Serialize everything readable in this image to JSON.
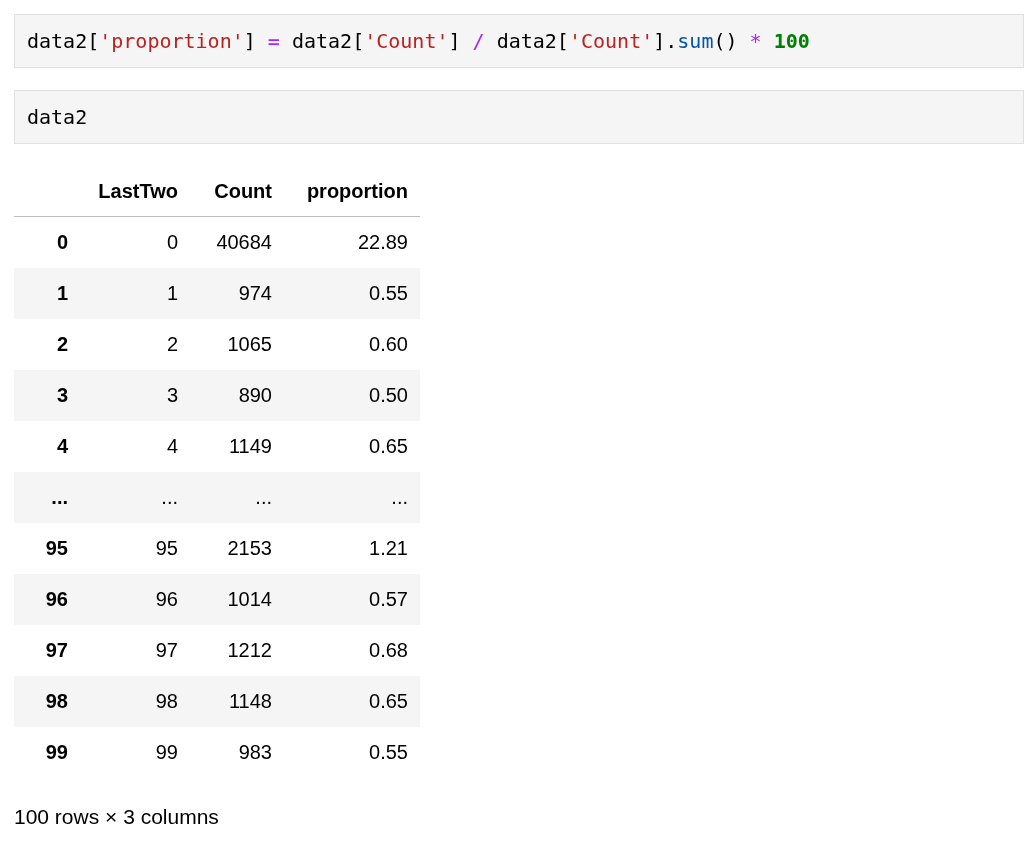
{
  "cells": [
    {
      "code": [
        {
          "kind": "name",
          "text": "data2["
        },
        {
          "kind": "string",
          "text": "'proportion'"
        },
        {
          "kind": "name",
          "text": "] "
        },
        {
          "kind": "operator",
          "text": "="
        },
        {
          "kind": "name",
          "text": " data2["
        },
        {
          "kind": "string",
          "text": "'Count'"
        },
        {
          "kind": "name",
          "text": "] "
        },
        {
          "kind": "operator",
          "text": "/"
        },
        {
          "kind": "name",
          "text": " data2["
        },
        {
          "kind": "string",
          "text": "'Count'"
        },
        {
          "kind": "name",
          "text": "]."
        },
        {
          "kind": "call",
          "text": "sum"
        },
        {
          "kind": "name",
          "text": "() "
        },
        {
          "kind": "operator",
          "text": "* "
        },
        {
          "kind": "number",
          "text": "100"
        }
      ]
    },
    {
      "code": [
        {
          "kind": "name",
          "text": "data2"
        }
      ]
    }
  ],
  "table": {
    "columns": [
      "LastTwo",
      "Count",
      "proportion"
    ],
    "rows": [
      {
        "index": "0",
        "cells": [
          "0",
          "40684",
          "22.89"
        ]
      },
      {
        "index": "1",
        "cells": [
          "1",
          "974",
          "0.55"
        ]
      },
      {
        "index": "2",
        "cells": [
          "2",
          "1065",
          "0.60"
        ]
      },
      {
        "index": "3",
        "cells": [
          "3",
          "890",
          "0.50"
        ]
      },
      {
        "index": "4",
        "cells": [
          "4",
          "1149",
          "0.65"
        ]
      },
      {
        "index": "...",
        "cells": [
          "...",
          "...",
          "..."
        ]
      },
      {
        "index": "95",
        "cells": [
          "95",
          "2153",
          "1.21"
        ]
      },
      {
        "index": "96",
        "cells": [
          "96",
          "1014",
          "0.57"
        ]
      },
      {
        "index": "97",
        "cells": [
          "97",
          "1212",
          "0.68"
        ]
      },
      {
        "index": "98",
        "cells": [
          "98",
          "1148",
          "0.65"
        ]
      },
      {
        "index": "99",
        "cells": [
          "99",
          "983",
          "0.55"
        ]
      }
    ]
  },
  "footer": "100 rows × 3 columns"
}
